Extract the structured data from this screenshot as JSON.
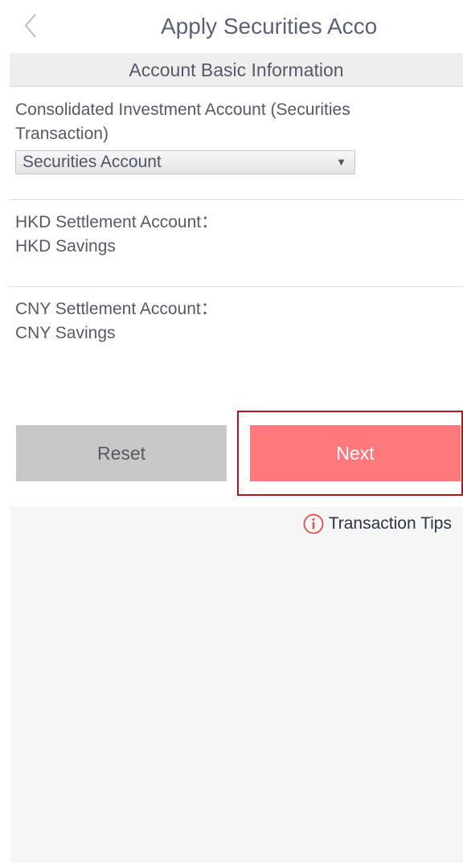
{
  "header": {
    "title": "Apply Securities Acco"
  },
  "section": {
    "title": "Account Basic Information"
  },
  "consolidated": {
    "label": "Consolidated Investment Account (Securities Transaction)",
    "selected": "Securities Account"
  },
  "hkd": {
    "label": "HKD Settlement Account：",
    "value": "HKD Savings"
  },
  "cny": {
    "label": "CNY Settlement Account：",
    "value": "CNY Savings"
  },
  "buttons": {
    "reset": "Reset",
    "next": "Next"
  },
  "tips": {
    "label": "Transaction Tips"
  },
  "icons": {
    "back": "chevron-left-icon",
    "info": "info-icon",
    "dropdown": "triangle-down-icon"
  },
  "colors": {
    "next_button": "#ff787b",
    "reset_button": "#c8c8c8",
    "highlight_border": "#b0151c",
    "info_icon": "#e8474c"
  }
}
